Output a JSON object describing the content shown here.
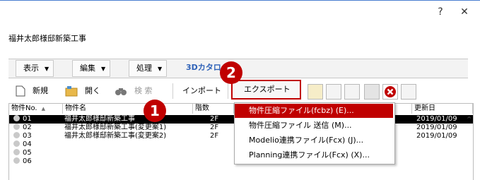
{
  "window": {
    "help_label": "?",
    "close_label": "✕",
    "title": "福井太郎様邸新築工事"
  },
  "menubar": {
    "view": "表示",
    "edit": "編集",
    "process": "処理",
    "catalog_logo": "3Dカタログ"
  },
  "toolbar": {
    "new": "新規",
    "open": "開く",
    "search": "検 索",
    "import": "インポート",
    "export": "エクスポート"
  },
  "table": {
    "headers": [
      "物件No.",
      "物件名",
      "階数",
      "更新日"
    ],
    "rows": [
      {
        "no": "01",
        "name": "福井太郎様邸新築工事",
        "floors": "2F",
        "date": "2019/01/09"
      },
      {
        "no": "02",
        "name": "福井太郎様邸新築工事(変更案1)",
        "floors": "2F",
        "date": "2019/01/09"
      },
      {
        "no": "03",
        "name": "福井太郎様邸新築工事(変更案2)",
        "floors": "2F",
        "date": "2019/01/09"
      },
      {
        "no": "04",
        "name": "",
        "floors": "",
        "date": ""
      },
      {
        "no": "05",
        "name": "",
        "floors": "",
        "date": ""
      },
      {
        "no": "06",
        "name": "",
        "floors": "",
        "date": ""
      }
    ]
  },
  "export_menu": {
    "items": [
      "物件圧縮ファイル(fcbz) (E)...",
      "物件圧縮ファイル 送信 (M)...",
      "Modelio連携ファイル(Fcx) (J)...",
      "Planning連携ファイル(Fcx) (X)..."
    ]
  },
  "annotations": {
    "step1": "1",
    "step2": "2"
  },
  "colors": {
    "accent_red": "#c00000",
    "selection_black": "#000000",
    "title_line_blue": "#4a7fd0"
  }
}
